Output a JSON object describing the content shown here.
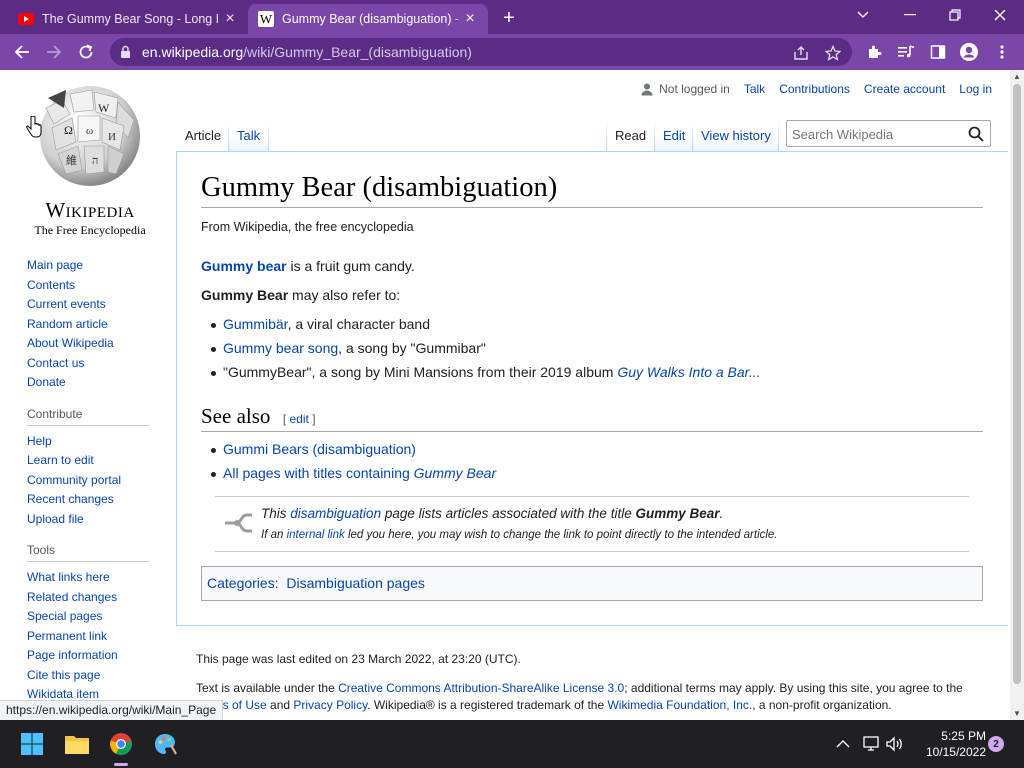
{
  "browser": {
    "tabs": [
      {
        "title": "The Gummy Bear Song - Long Er",
        "favicon": "youtube-icon",
        "active": false
      },
      {
        "title": "Gummy Bear (disambiguation) -",
        "favicon": "wikipedia-icon",
        "active": true
      }
    ],
    "url_host": "en.wikipedia.org",
    "url_path": "/wiki/Gummy_Bear_(disambiguation)",
    "accent_color": "#7a46a8",
    "tabbar_color": "#5c2b83"
  },
  "wiki": {
    "wordmark": "Wikipedia",
    "tagline": "The Free Encyclopedia",
    "userlinks": {
      "not_logged_in": "Not logged in",
      "talk": "Talk",
      "contributions": "Contributions",
      "create_account": "Create account",
      "log_in": "Log in"
    },
    "tabs": {
      "article": "Article",
      "talk": "Talk",
      "read": "Read",
      "edit": "Edit",
      "view_history": "View history"
    },
    "search": {
      "placeholder": "Search Wikipedia"
    },
    "sidebar": {
      "navigation": [
        "Main page",
        "Contents",
        "Current events",
        "Random article",
        "About Wikipedia",
        "Contact us",
        "Donate"
      ],
      "contribute_heading": "Contribute",
      "contribute": [
        "Help",
        "Learn to edit",
        "Community portal",
        "Recent changes",
        "Upload file"
      ],
      "tools_heading": "Tools",
      "tools": [
        "What links here",
        "Related changes",
        "Special pages",
        "Permanent link",
        "Page information",
        "Cite this page",
        "Wikidata item"
      ]
    },
    "article": {
      "title": "Gummy Bear (disambiguation)",
      "site_sub": "From Wikipedia, the free encyclopedia",
      "intro_link": "Gummy bear",
      "intro_rest": " is a fruit gum candy.",
      "may_refer_bold": "Gummy Bear",
      "may_refer_rest": " may also refer to:",
      "items": [
        {
          "link": "Gummibär",
          "rest": ", a viral character band"
        },
        {
          "link": "Gummy bear song",
          "rest": ", a song by \"Gummibar\""
        },
        {
          "pre": "\"GummyBear\", a song by Mini Mansions from their 2019 album ",
          "link": "Guy Walks Into a Bar..."
        }
      ],
      "see_also_heading": "See also",
      "edit_link": "edit",
      "see_also_items": [
        {
          "link": "Gummi Bears (disambiguation)"
        },
        {
          "link": "All pages with titles containing ",
          "link_italic": "Gummy Bear"
        }
      ],
      "dmbox": {
        "l1_pre": "This ",
        "l1_link": "disambiguation",
        "l1_mid": " page lists articles associated with the title ",
        "l1_bold": "Gummy Bear",
        "l1_end": ".",
        "l2_pre": "If an ",
        "l2_link": "internal link",
        "l2_rest": " led you here, you may wish to change the link to point directly to the intended article."
      },
      "categories_label": "Categories",
      "categories": [
        "Disambiguation pages"
      ]
    },
    "footer": {
      "last_edited": "This page was last edited on 23 March 2022, at 23:20 (UTC).",
      "license_pre": "Text is available under the ",
      "license_link": "Creative Commons Attribution-ShareAlike License 3.0",
      "license_mid": "; additional terms may apply. By using this site, you agree to the ",
      "terms_link": "Terms of Use",
      "and": " and ",
      "privacy_link": "Privacy Policy",
      "reg_pre": ". Wikipedia® is a registered trademark of the ",
      "wmf_link": "Wikimedia Foundation, Inc.",
      "reg_end": ", a non-profit organization."
    }
  },
  "status_url": "https://en.wikipedia.org/wiki/Main_Page",
  "taskbar": {
    "time": "5:25 PM",
    "date": "10/15/2022",
    "notifications": "2"
  }
}
